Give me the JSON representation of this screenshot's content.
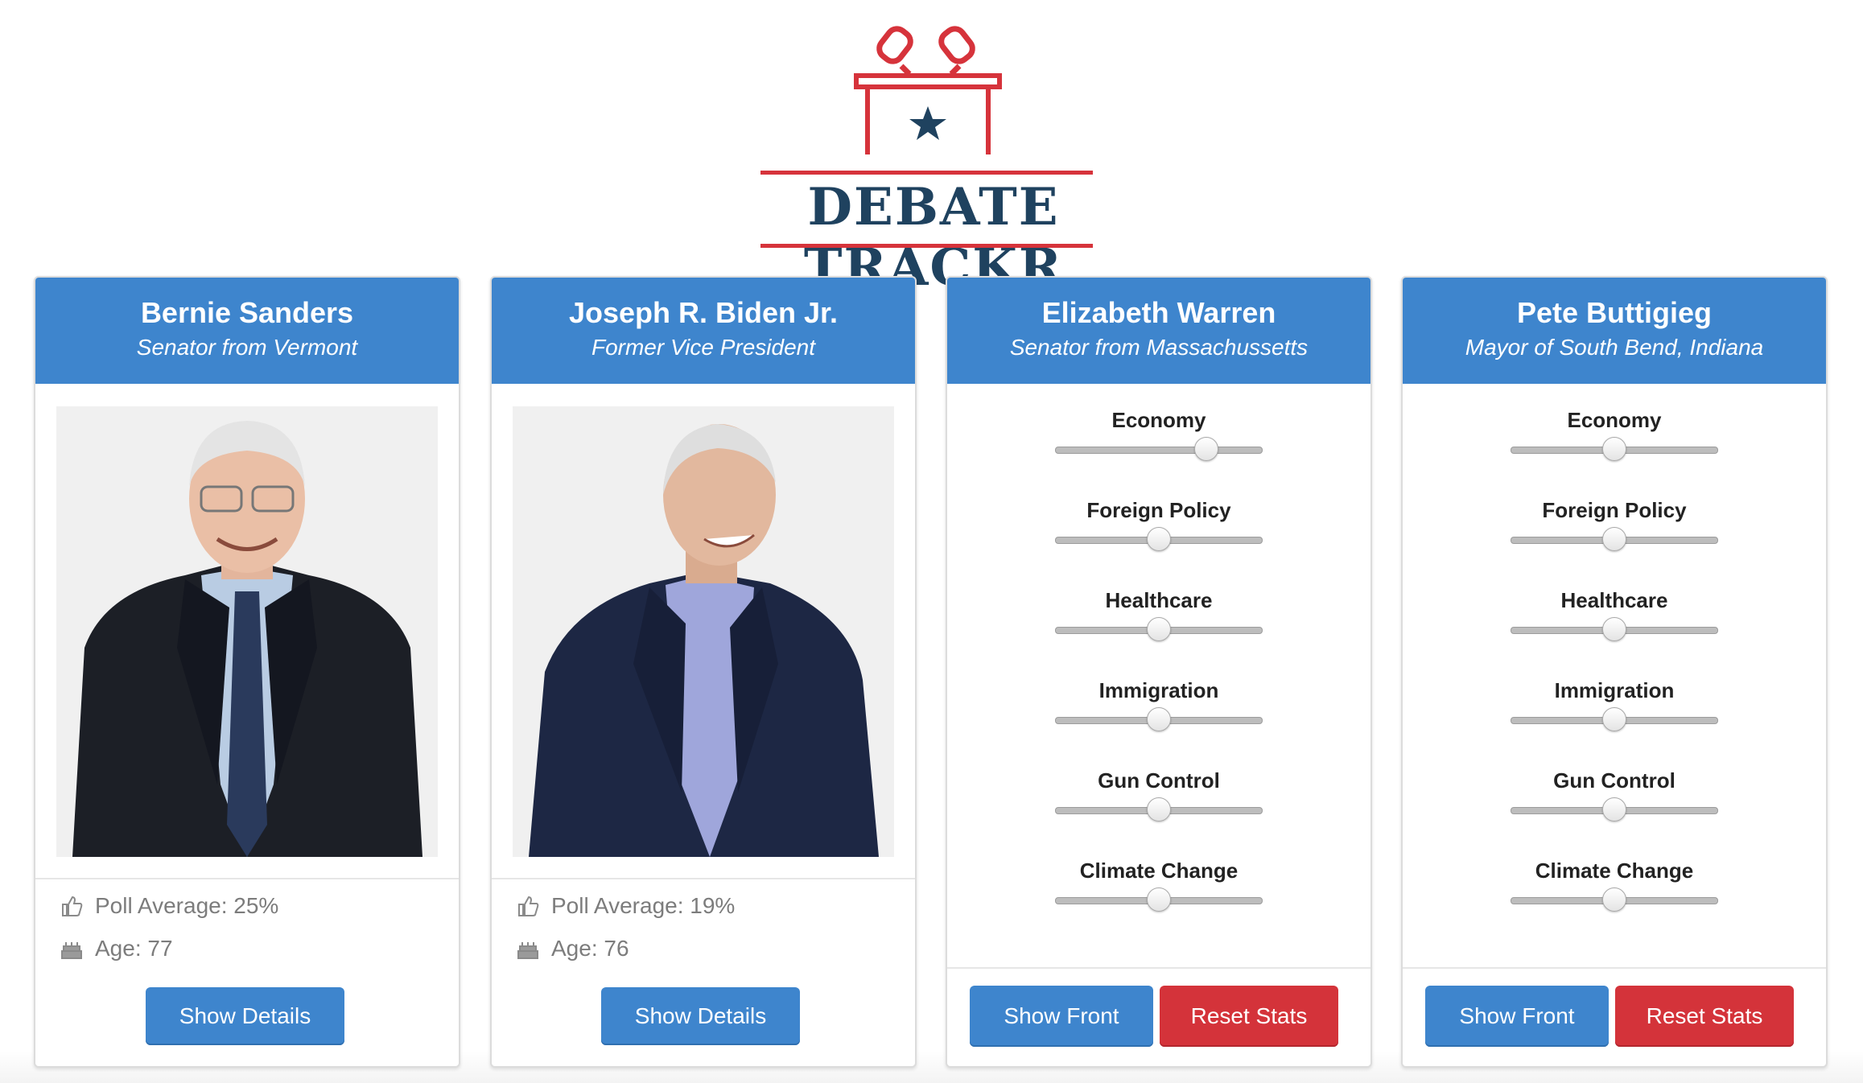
{
  "app": {
    "title": "DEBATE TRACKR",
    "colors": {
      "primary": "#3e85cd",
      "danger": "#d4333a",
      "brand_navy": "#1f425f",
      "brand_red": "#d6333b"
    }
  },
  "cards": [
    {
      "name": "Bernie Sanders",
      "subtitle": "Senator from Vermont",
      "side": "front",
      "poll_label": "Poll Average: 25%",
      "age_label": "Age: 77",
      "show_details_label": "Show Details",
      "poll_icon": "thumbs-up-icon",
      "age_icon": "birthday-cake-icon"
    },
    {
      "name": "Joseph R. Biden Jr.",
      "subtitle": "Former Vice President",
      "side": "front",
      "poll_label": "Poll Average: 19%",
      "age_label": "Age: 76",
      "show_details_label": "Show Details",
      "poll_icon": "thumbs-up-icon",
      "age_icon": "birthday-cake-icon"
    },
    {
      "name": "Elizabeth Warren",
      "subtitle": "Senator from Massachussetts",
      "side": "back",
      "sliders": [
        {
          "label": "Economy",
          "value": 0.73
        },
        {
          "label": "Foreign Policy",
          "value": 0.5
        },
        {
          "label": "Healthcare",
          "value": 0.5
        },
        {
          "label": "Immigration",
          "value": 0.5
        },
        {
          "label": "Gun Control",
          "value": 0.5
        },
        {
          "label": "Climate Change",
          "value": 0.5
        }
      ],
      "show_front_label": "Show Front",
      "reset_label": "Reset Stats"
    },
    {
      "name": "Pete Buttigieg",
      "subtitle": "Mayor of South Bend, Indiana",
      "side": "back",
      "sliders": [
        {
          "label": "Economy",
          "value": 0.5
        },
        {
          "label": "Foreign Policy",
          "value": 0.5
        },
        {
          "label": "Healthcare",
          "value": 0.5
        },
        {
          "label": "Immigration",
          "value": 0.5
        },
        {
          "label": "Gun Control",
          "value": 0.5
        },
        {
          "label": "Climate Change",
          "value": 0.5
        }
      ],
      "show_front_label": "Show Front",
      "reset_label": "Reset Stats"
    }
  ]
}
